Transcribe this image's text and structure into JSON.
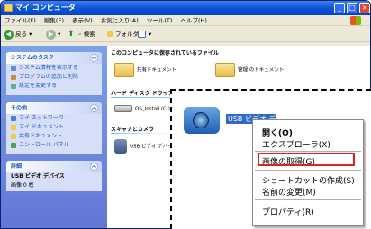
{
  "window": {
    "title": "マイ コンピュータ"
  },
  "menubar": [
    "ファイル(F)",
    "編集(E)",
    "表示(V)",
    "お気に入り(A)",
    "ツール(T)",
    "ヘルプ(H)"
  ],
  "toolbar": {
    "back": "戻る",
    "search": "検索",
    "folders": "フォルダ"
  },
  "tasks": {
    "system": {
      "title": "システムのタスク",
      "items": [
        "システム情報を表示する",
        "プログラムの追加と削除",
        "設定を変更する"
      ]
    },
    "other": {
      "title": "その他",
      "items": [
        "マイ ネットワーク",
        "マイ ドキュメント",
        "共有ドキュメント",
        "コントロール パネル"
      ]
    },
    "details": {
      "title": "詳細",
      "name": "USB ビデオ デバイス",
      "sub": "画像 0 枚"
    }
  },
  "groups": {
    "files": "このコンピュータに保存されているファイル",
    "drives": "ハード ディスク ドライブ",
    "scanners": "スキャナとカメラ"
  },
  "items": {
    "shared": "共有ドキュメント",
    "mydocs": "管理 のドキュメント",
    "osdrive": "OS_Install (C:)",
    "usbsmall": "USB ビデオ デバイ"
  },
  "zoom": {
    "selected_label": "USB ビデオ デ"
  },
  "context_menu": {
    "open": "開く(O)",
    "explorer": "エクスプローラ(X)",
    "get_picture": "画像の取得(G)",
    "shortcut": "ショートカットの作成(S)",
    "rename": "名前の変更(M)",
    "properties": "プロパティ(R)"
  }
}
